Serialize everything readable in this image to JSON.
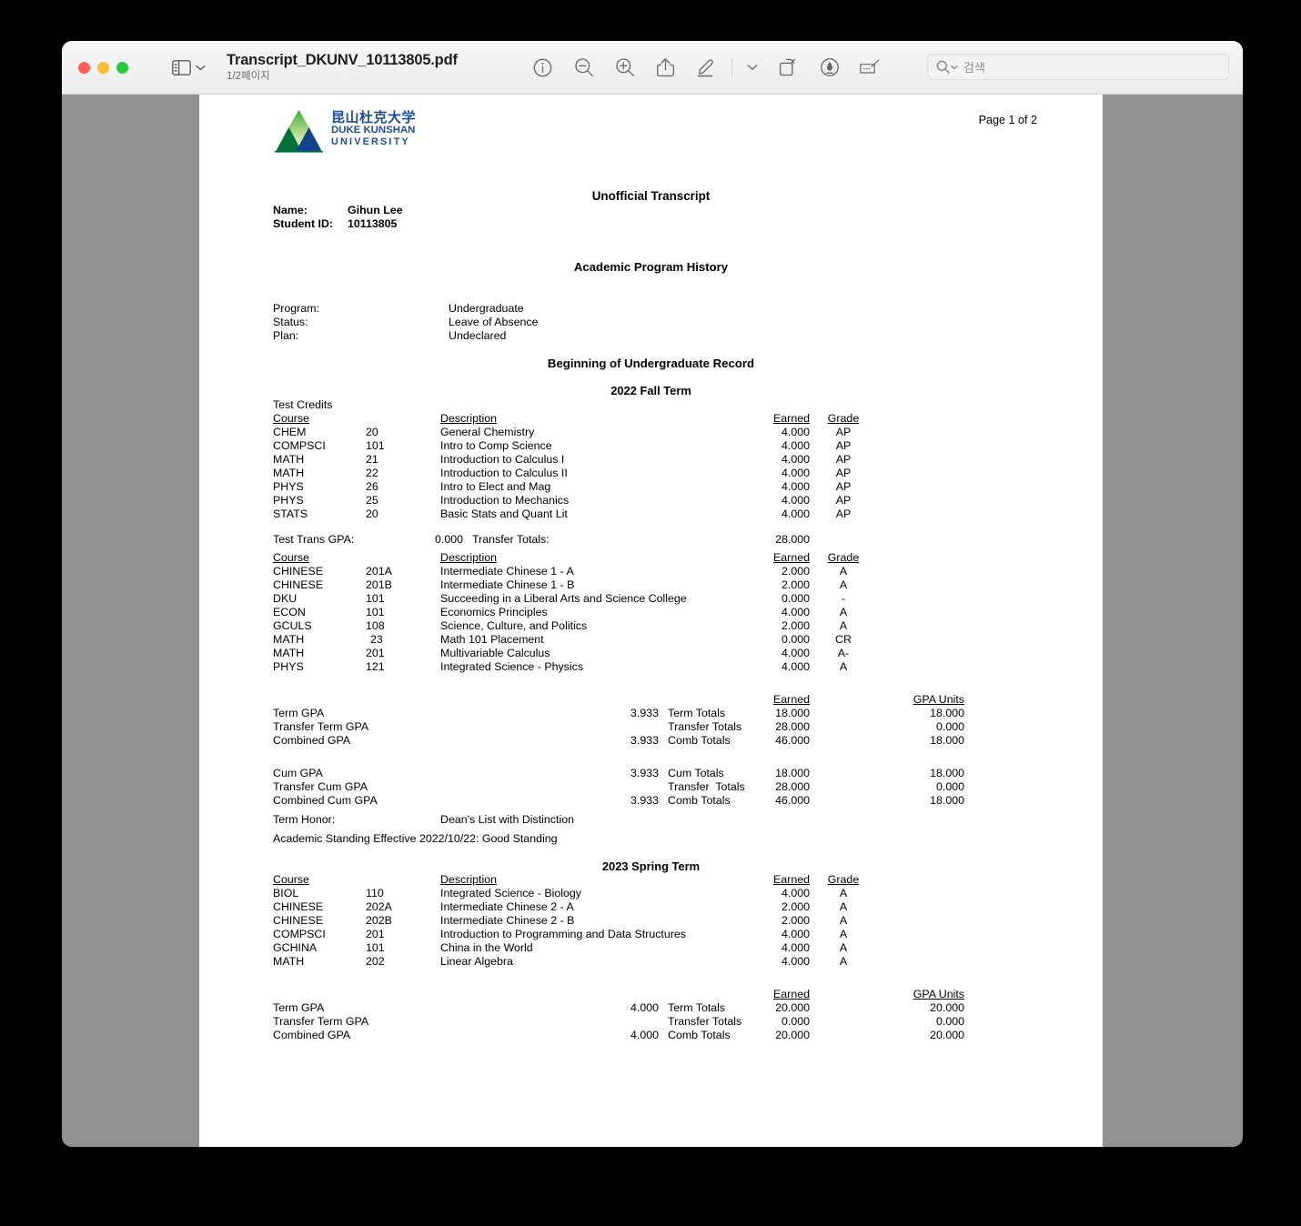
{
  "window": {
    "traffic_lights": [
      "close",
      "minimize",
      "maximize"
    ],
    "doc_title": "Transcript_DKUNV_10113805.pdf",
    "page_indicator": "1/2페이지",
    "toolbar_icons": [
      "info-icon",
      "zoom-out-icon",
      "zoom-in-icon",
      "share-icon",
      "markup-pen-icon",
      "chevron-down-icon",
      "rotate-icon",
      "annotate-icon",
      "signature-icon"
    ],
    "search": {
      "placeholder": "검색",
      "value": ""
    }
  },
  "document": {
    "page_label": "Page 1 of 2",
    "logo": {
      "chinese": "昆山杜克大学",
      "line1": "DUKE KUNSHAN",
      "line2": "UNIVERSITY",
      "brand_blue": "#1d4f91",
      "brand_green": "#00703c",
      "brand_navy": "#12428c"
    },
    "title": "Unofficial Transcript",
    "identity": [
      {
        "label": "Name:",
        "value": "Gihun Lee"
      },
      {
        "label": "Student ID:",
        "value": "10113805"
      }
    ],
    "program_history_heading": "Academic Program History",
    "program": [
      {
        "label": "Program:",
        "value": "Undergraduate"
      },
      {
        "label": "Status:",
        "value": "Leave of Absence"
      },
      {
        "label": "Plan:",
        "value": "Undeclared"
      }
    ],
    "record_heading": "Beginning of Undergraduate Record",
    "terms": [
      {
        "name": "2022 Fall Term",
        "subheading": "Test Credits",
        "headers": {
          "course": "Course",
          "description": "Description",
          "earned": "Earned",
          "grade": "Grade"
        },
        "test_courses": [
          {
            "subject": "CHEM",
            "number": "20",
            "description": "General Chemistry",
            "earned": "4.000",
            "grade": "AP"
          },
          {
            "subject": "COMPSCI",
            "number": "101",
            "description": "Intro to Comp Science",
            "earned": "4.000",
            "grade": "AP"
          },
          {
            "subject": "MATH",
            "number": "21",
            "description": "Introduction to Calculus I",
            "earned": "4.000",
            "grade": "AP"
          },
          {
            "subject": "MATH",
            "number": "22",
            "description": "Introduction to Calculus II",
            "earned": "4.000",
            "grade": "AP"
          },
          {
            "subject": "PHYS",
            "number": "26",
            "description": "Intro to Elect and Mag",
            "earned": "4.000",
            "grade": "AP"
          },
          {
            "subject": "PHYS",
            "number": "25",
            "description": "Introduction to Mechanics",
            "earned": "4.000",
            "grade": "AP"
          },
          {
            "subject": "STATS",
            "number": "20",
            "description": "Basic Stats and Quant Lit",
            "earned": "4.000",
            "grade": "AP"
          }
        ],
        "test_trans": {
          "label": "Test Trans GPA:",
          "gpa": "0.000",
          "totals_label": "Transfer Totals:",
          "totals": "28.000"
        },
        "courses": [
          {
            "subject": "CHINESE",
            "number": "201A",
            "description": "Intermediate Chinese 1 - A",
            "earned": "2.000",
            "grade": "A"
          },
          {
            "subject": "CHINESE",
            "number": "201B",
            "description": "Intermediate Chinese 1 - B",
            "earned": "2.000",
            "grade": "A"
          },
          {
            "subject": "DKU",
            "number": "101",
            "description": "Succeeding in a Liberal Arts and Science College",
            "earned": "0.000",
            "grade": "-"
          },
          {
            "subject": "ECON",
            "number": "101",
            "description": "Economics Principles",
            "earned": "4.000",
            "grade": "A"
          },
          {
            "subject": "GCULS",
            "number": "108",
            "description": "Science, Culture, and Politics",
            "earned": "2.000",
            "grade": "A"
          },
          {
            "subject": "MATH",
            "number": "23",
            "description": "Math 101 Placement",
            "earned": "0.000",
            "grade": "CR"
          },
          {
            "subject": "MATH",
            "number": "201",
            "description": "Multivariable Calculus",
            "earned": "4.000",
            "grade": "A-"
          },
          {
            "subject": "PHYS",
            "number": "121",
            "description": "Integrated Science - Physics",
            "earned": "4.000",
            "grade": "A"
          }
        ],
        "totals_headers": {
          "earned": "Earned",
          "gpa_units": "GPA Units"
        },
        "term_totals": [
          {
            "gpa_label": "Term GPA",
            "gpa": "3.933",
            "totals_label": "Term Totals",
            "earned": "18.000",
            "gpa_units": "18.000"
          },
          {
            "gpa_label": "Transfer Term GPA",
            "gpa": "",
            "totals_label": "Transfer Totals",
            "earned": "28.000",
            "gpa_units": "0.000"
          },
          {
            "gpa_label": "Combined GPA",
            "gpa": "3.933",
            "totals_label": "Comb Totals",
            "earned": "46.000",
            "gpa_units": "18.000"
          }
        ],
        "cum_totals": [
          {
            "gpa_label": "Cum GPA",
            "gpa": "3.933",
            "totals_label": "Cum Totals",
            "earned": "18.000",
            "gpa_units": "18.000"
          },
          {
            "gpa_label": "Transfer Cum GPA",
            "gpa": "",
            "totals_label": "Transfer  Totals",
            "earned": "28.000",
            "gpa_units": "0.000"
          },
          {
            "gpa_label": "Combined Cum GPA",
            "gpa": "3.933",
            "totals_label": "Comb Totals",
            "earned": "46.000",
            "gpa_units": "18.000"
          }
        ],
        "term_honor": {
          "label": "Term Honor:",
          "value": "Dean's List with Distinction"
        },
        "academic_standing": "Academic Standing Effective 2022/10/22: Good Standing"
      },
      {
        "name": "2023 Spring Term",
        "headers": {
          "course": "Course",
          "description": "Description",
          "earned": "Earned",
          "grade": "Grade"
        },
        "courses": [
          {
            "subject": "BIOL",
            "number": "110",
            "description": "Integrated Science - Biology",
            "earned": "4.000",
            "grade": "A"
          },
          {
            "subject": "CHINESE",
            "number": "202A",
            "description": "Intermediate Chinese 2 - A",
            "earned": "2.000",
            "grade": "A"
          },
          {
            "subject": "CHINESE",
            "number": "202B",
            "description": "Intermediate Chinese 2 - B",
            "earned": "2.000",
            "grade": "A"
          },
          {
            "subject": "COMPSCI",
            "number": "201",
            "description": "Introduction to Programming and Data Structures",
            "earned": "4.000",
            "grade": "A"
          },
          {
            "subject": "GCHINA",
            "number": "101",
            "description": "China in the World",
            "earned": "4.000",
            "grade": "A"
          },
          {
            "subject": "MATH",
            "number": "202",
            "description": "Linear Algebra",
            "earned": "4.000",
            "grade": "A"
          }
        ],
        "totals_headers": {
          "earned": "Earned",
          "gpa_units": "GPA Units"
        },
        "term_totals": [
          {
            "gpa_label": "Term GPA",
            "gpa": "4.000",
            "totals_label": "Term Totals",
            "earned": "20.000",
            "gpa_units": "20.000"
          },
          {
            "gpa_label": "Transfer Term GPA",
            "gpa": "",
            "totals_label": "Transfer Totals",
            "earned": "0.000",
            "gpa_units": "0.000"
          },
          {
            "gpa_label": "Combined GPA",
            "gpa": "4.000",
            "totals_label": "Comb Totals",
            "earned": "20.000",
            "gpa_units": "20.000"
          }
        ]
      }
    ]
  }
}
